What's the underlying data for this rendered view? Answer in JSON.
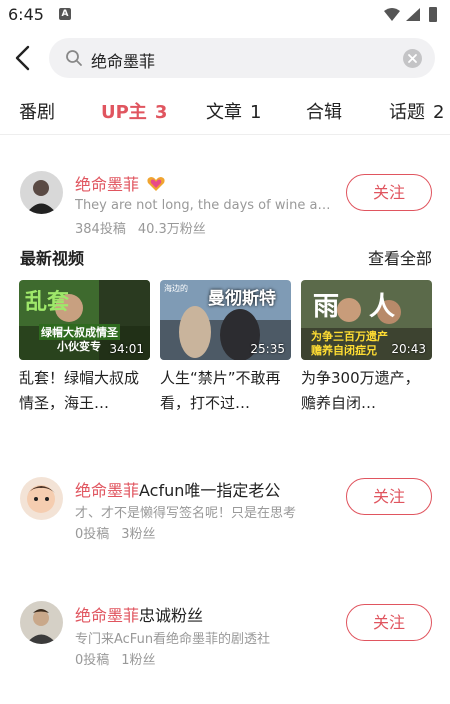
{
  "status": {
    "time": "6:45",
    "notif_icon": "A"
  },
  "search": {
    "query": "绝命墨菲"
  },
  "tabs": [
    {
      "label": "番剧",
      "count": ""
    },
    {
      "label": "UP主",
      "count": "3"
    },
    {
      "label": "文章",
      "count": "1"
    },
    {
      "label": "合辑",
      "count": ""
    },
    {
      "label": "话题",
      "count": "2"
    }
  ],
  "users": [
    {
      "name_hl": "绝命墨菲",
      "name_rest": "",
      "signature": "They are not long, the days of wine and roses",
      "posts": "384投稿",
      "fans": "40.3万粉丝",
      "follow_label": "关注",
      "badge_icon": "heart-badge-icon"
    },
    {
      "name_hl": "绝命墨菲",
      "name_rest": "Acfun唯一指定老公",
      "signature": "才、才不是懒得写签名呢！只是在思考",
      "posts": "0投稿",
      "fans": "3粉丝",
      "follow_label": "关注"
    },
    {
      "name_hl": "绝命墨菲",
      "name_rest": "忠诚粉丝",
      "signature": "专门来AcFun看绝命墨菲的剧透社",
      "posts": "0投稿",
      "fans": "1粉丝",
      "follow_label": "关注"
    }
  ],
  "latest": {
    "heading": "最新视频",
    "see_all": "查看全部",
    "videos": [
      {
        "title": "乱套！绿帽大叔成情圣，海王…",
        "duration": "34:01",
        "thumb_text": "乱套",
        "thumb_sub": "绿帽大叔成情圣",
        "thumb_sub2": "小伙变专"
      },
      {
        "title": "人生“禁片”不敢再看，打不过…",
        "duration": "25:35",
        "thumb_text": "曼彻斯特",
        "thumb_sub": "海边的",
        "thumb_sub2": ""
      },
      {
        "title": "为争300万遗产，赡养自闭…",
        "duration": "20:43",
        "thumb_text": "雨人",
        "thumb_sub": "为争三百万遗产",
        "thumb_sub2": "赡养自闭症兄"
      }
    ]
  },
  "colors": {
    "accent": "#e0555f",
    "muted": "#999999"
  }
}
